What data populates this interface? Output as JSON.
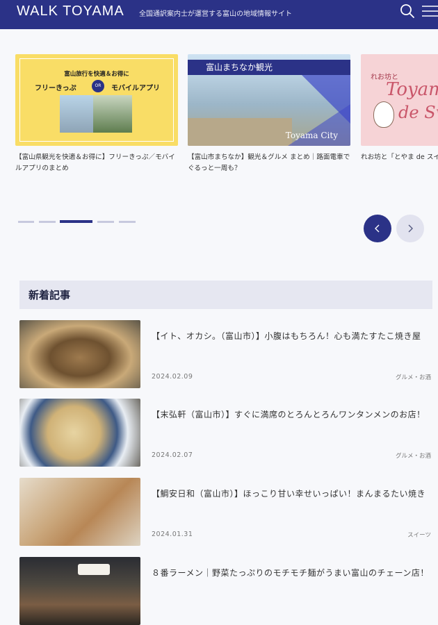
{
  "header": {
    "logo": "WALK TOYAMA",
    "tagline": "全国通訳案内士が運営する富山の地域情報サイト",
    "bg_color": "#2b3287"
  },
  "carousel": {
    "cards": [
      {
        "title": "【富山県観光を快適＆お得に】フリーきっぷ／モバイルアプリのまとめ",
        "image_text": {
          "line1": "富山旅行を快適＆お得に",
          "left": "フリーきっぷ",
          "or": "OR",
          "right": "モバイルアプリ"
        }
      },
      {
        "title": "【富山市まちなか】観光＆グルメ まとめ｜路面電車でぐるっと一周も？",
        "image_text": {
          "banner": "富山まちなか観光",
          "caption": "Toyama City"
        }
      },
      {
        "title": "れお坊と「とやま de スイーツ」",
        "image_text": {
          "line1": "れお坊と",
          "line2": "Toyama",
          "line3": "de Sweets"
        }
      }
    ],
    "active_index": 2,
    "dot_count": 5
  },
  "new_articles": {
    "heading": "新着記事",
    "items": [
      {
        "title": "【イト、オカシ。（富山市）】小腹はもちろん！心も満たすたこ焼き屋",
        "date": "2024.02.09",
        "category": "グルメ・お酒"
      },
      {
        "title": "【末弘軒（富山市）】すぐに満席のとろんとろんワンタンメンのお店！",
        "date": "2024.02.07",
        "category": "グルメ・お酒"
      },
      {
        "title": "【鯛安日和（富山市）】ほっこり甘い幸せいっぱい！まんまるたい焼き",
        "date": "2024.01.31",
        "category": "スイーツ"
      },
      {
        "title": "８番ラーメン｜野菜たっぷりのモチモチ麺がうまい富山のチェーン店！",
        "date": "",
        "category": ""
      }
    ]
  },
  "icons": {
    "search": "search-icon",
    "menu": "hamburger-menu-icon",
    "prev": "chevron-left-icon",
    "next": "chevron-right-icon"
  }
}
